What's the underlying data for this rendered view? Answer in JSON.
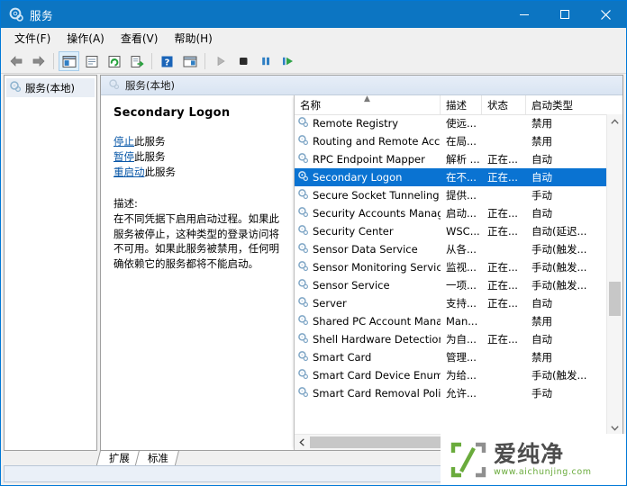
{
  "window": {
    "title": "服务",
    "title_icon": "services-gear-icon",
    "controls": {
      "minimize": "minimize-icon",
      "maximize": "maximize-icon",
      "close": "close-icon"
    }
  },
  "menubar": {
    "items": [
      {
        "label": "文件(F)",
        "name": "menu-file"
      },
      {
        "label": "操作(A)",
        "name": "menu-action"
      },
      {
        "label": "查看(V)",
        "name": "menu-view"
      },
      {
        "label": "帮助(H)",
        "name": "menu-help"
      }
    ]
  },
  "toolbar": {
    "buttons": [
      {
        "icon": "back-arrow-icon",
        "name": "toolbar-back"
      },
      {
        "icon": "forward-arrow-icon",
        "name": "toolbar-forward"
      },
      {
        "icon": "show-tree-icon",
        "name": "toolbar-show-tree"
      },
      {
        "icon": "properties-icon",
        "name": "toolbar-properties"
      },
      {
        "icon": "refresh-icon",
        "name": "toolbar-refresh"
      },
      {
        "icon": "export-list-icon",
        "name": "toolbar-export"
      },
      {
        "icon": "help-icon",
        "name": "toolbar-help"
      },
      {
        "icon": "show-hide-console-icon",
        "name": "toolbar-console-tree"
      },
      {
        "icon": "play-icon",
        "name": "toolbar-start-service"
      },
      {
        "icon": "stop-icon",
        "name": "toolbar-stop-service"
      },
      {
        "icon": "pause-icon",
        "name": "toolbar-pause-service"
      },
      {
        "icon": "restart-icon",
        "name": "toolbar-restart-service"
      }
    ]
  },
  "tree": {
    "root": {
      "label": "服务(本地)",
      "icon": "services-gear-icon"
    }
  },
  "mid_pane": {
    "header": "服务(本地)",
    "header_icon": "services-gear-icon",
    "details": {
      "service_name": "Secondary Logon",
      "links": [
        {
          "link": "停止",
          "suffix": "此服务",
          "name": "stop-service-link"
        },
        {
          "link": "暂停",
          "suffix": "此服务",
          "name": "pause-service-link"
        },
        {
          "link": "重启动",
          "suffix": "此服务",
          "name": "restart-service-link"
        }
      ],
      "description_label": "描述:",
      "description_text": "在不同凭据下启用启动过程。如果此服务被停止，这种类型的登录访问将不可用。如果此服务被禁用，任何明确依赖它的服务都将不能启动。"
    }
  },
  "list": {
    "columns": [
      {
        "label": "名称",
        "name": "column-name",
        "sorted": true
      },
      {
        "label": "描述",
        "name": "column-description"
      },
      {
        "label": "状态",
        "name": "column-status"
      },
      {
        "label": "启动类型",
        "name": "column-startup-type"
      }
    ],
    "sort_indicator": "▲",
    "rows": [
      {
        "name": "Remote Registry",
        "desc": "使远...",
        "state": "",
        "startup": "禁用",
        "selected": false
      },
      {
        "name": "Routing and Remote Acc...",
        "desc": "在局...",
        "state": "",
        "startup": "禁用",
        "selected": false
      },
      {
        "name": "RPC Endpoint Mapper",
        "desc": "解析 ...",
        "state": "正在...",
        "startup": "自动",
        "selected": false
      },
      {
        "name": "Secondary Logon",
        "desc": "在不...",
        "state": "正在...",
        "startup": "自动",
        "selected": true
      },
      {
        "name": "Secure Socket Tunneling ...",
        "desc": "提供...",
        "state": "",
        "startup": "手动",
        "selected": false
      },
      {
        "name": "Security Accounts Manag...",
        "desc": "启动...",
        "state": "正在...",
        "startup": "自动",
        "selected": false
      },
      {
        "name": "Security Center",
        "desc": "WSC...",
        "state": "正在...",
        "startup": "自动(延迟...",
        "selected": false
      },
      {
        "name": "Sensor Data Service",
        "desc": "从各...",
        "state": "",
        "startup": "手动(触发...",
        "selected": false
      },
      {
        "name": "Sensor Monitoring Service",
        "desc": "监视...",
        "state": "正在...",
        "startup": "手动(触发...",
        "selected": false
      },
      {
        "name": "Sensor Service",
        "desc": "一项...",
        "state": "正在...",
        "startup": "手动(触发...",
        "selected": false
      },
      {
        "name": "Server",
        "desc": "支持...",
        "state": "正在...",
        "startup": "自动",
        "selected": false
      },
      {
        "name": "Shared PC Account Mana...",
        "desc": "Man...",
        "state": "",
        "startup": "禁用",
        "selected": false
      },
      {
        "name": "Shell Hardware Detection",
        "desc": "为自...",
        "state": "正在...",
        "startup": "自动",
        "selected": false
      },
      {
        "name": "Smart Card",
        "desc": "管理...",
        "state": "",
        "startup": "禁用",
        "selected": false
      },
      {
        "name": "Smart Card Device Enum...",
        "desc": "为给...",
        "state": "",
        "startup": "手动(触发...",
        "selected": false
      },
      {
        "name": "Smart Card Removal Poli...",
        "desc": "允许...",
        "state": "",
        "startup": "手动",
        "selected": false
      }
    ],
    "scroll": {
      "up_arrow": "chevron-up-icon",
      "down_arrow": "chevron-down-icon",
      "left_arrow": "chevron-left-icon"
    }
  },
  "tabs": [
    {
      "label": "扩展",
      "name": "tab-extended",
      "active": false
    },
    {
      "label": "标准",
      "name": "tab-standard",
      "active": true
    }
  ],
  "watermark": {
    "title": "爱纯净",
    "url": "www.aichunjing.com",
    "accent_color": "#6aab3c",
    "text_color": "#4d4d4d"
  },
  "colors": {
    "titlebar": "#0c75c2",
    "selection": "#0a73d2",
    "link": "#0a58a8",
    "chrome": "#f0f0f0"
  }
}
